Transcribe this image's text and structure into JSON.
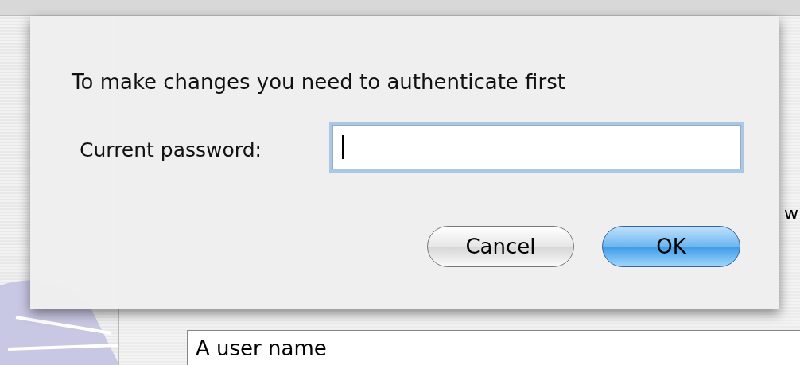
{
  "background": {
    "cut_text": "w",
    "user_name_field": {
      "value": "A user name"
    }
  },
  "dialog": {
    "message": "To make changes you need to authenticate first",
    "password": {
      "label": "Current password:",
      "focused": true
    },
    "buttons": [
      {
        "label": "Cancel",
        "default": false
      },
      {
        "label": "OK",
        "default": true
      }
    ]
  }
}
